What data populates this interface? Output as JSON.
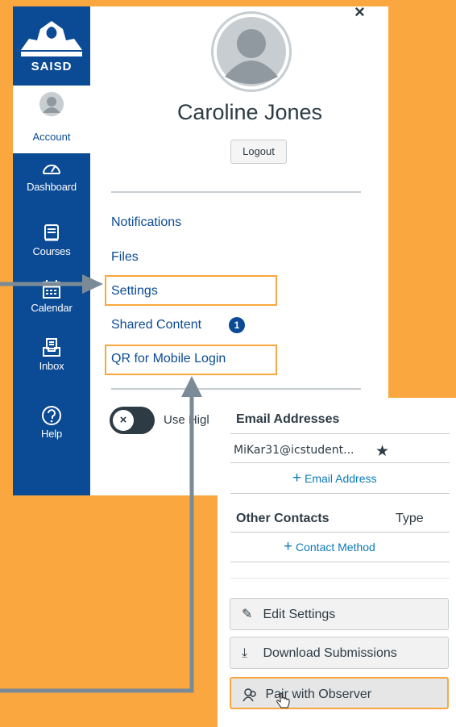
{
  "colors": {
    "background": "#F9A73E",
    "nav": "#0B4A94",
    "text": "#2d3b45",
    "link": "#0B4A94",
    "highlight": "#F9A73E",
    "connector": "#7A8B97"
  },
  "logo": {
    "text": "SAISD"
  },
  "nav": {
    "items": [
      {
        "label": "Account",
        "icon": "user-icon"
      },
      {
        "label": "Dashboard",
        "icon": "dashboard-icon"
      },
      {
        "label": "Courses",
        "icon": "courses-icon"
      },
      {
        "label": "Calendar",
        "icon": "calendar-icon"
      },
      {
        "label": "Inbox",
        "icon": "inbox-icon"
      },
      {
        "label": "Help",
        "icon": "help-icon"
      }
    ]
  },
  "tray": {
    "close": "×",
    "user_name": "Caroline Jones",
    "logout_label": "Logout",
    "links": [
      "Notifications",
      "Files",
      "Settings",
      "Shared Content",
      "QR for Mobile Login"
    ],
    "shared_badge": "1",
    "toggle_label": "Use Higl",
    "toggle_knob": "×"
  },
  "settings_card": {
    "email_header": "Email Addresses",
    "email_value": "MiKar31@icstudent...",
    "star": "★",
    "add_email": "Email Address",
    "contacts_header": "Other Contacts",
    "type_header": "Type",
    "add_contact": "Contact Method",
    "plus": "+",
    "buttons": [
      "Edit Settings",
      "Download Submissions",
      "Pair with Observer"
    ]
  }
}
